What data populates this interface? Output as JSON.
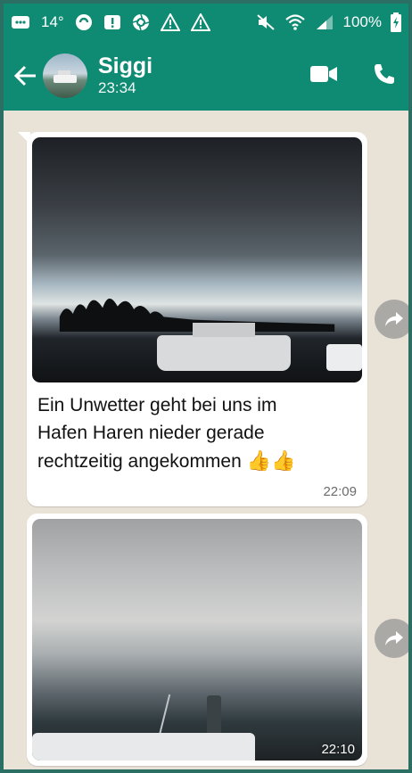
{
  "statusbar": {
    "temperature": "14°",
    "battery_percent": "100%"
  },
  "header": {
    "contact_name": "Siggi",
    "last_seen": "23:34"
  },
  "messages": [
    {
      "caption": "Ein Unwetter geht bei uns im\nHafen  Haren  nieder gerade\nrechtzeitig  angekommen",
      "emojis": "👍👍",
      "time": "22:09"
    },
    {
      "time": "22:10"
    }
  ],
  "colors": {
    "header_green": "#0f8a73",
    "chat_background": "#e9e2d7",
    "bubble": "#ffffff"
  },
  "icons": {
    "back": "arrow-left",
    "video": "video-camera",
    "call": "phone",
    "forward": "forward-arrow"
  }
}
